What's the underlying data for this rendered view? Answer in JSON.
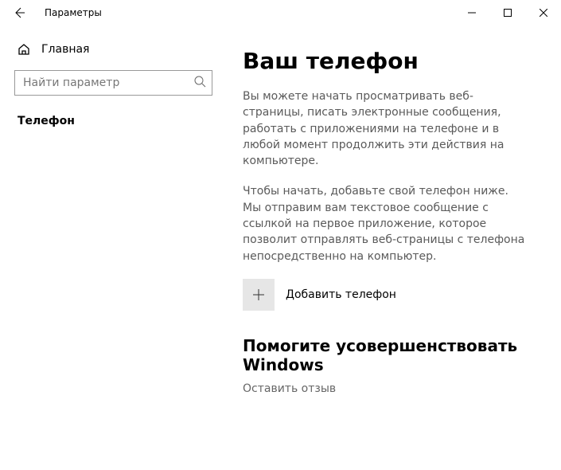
{
  "titlebar": {
    "title": "Параметры"
  },
  "sidebar": {
    "home_label": "Главная",
    "search_placeholder": "Найти параметр",
    "nav": {
      "phone_label": "Телефон"
    }
  },
  "content": {
    "title": "Ваш телефон",
    "paragraph1": "Вы можете начать просматривать веб-страницы, писать электронные сообщения, работать с приложениями на телефоне и в любой момент продолжить эти действия на компьютере.",
    "paragraph2": "Чтобы начать, добавьте свой телефон ниже. Мы отправим вам текстовое сообщение с ссылкой на первое приложение, которое позволит отправлять веб-страницы с телефона непосредственно на компьютер.",
    "add_phone_label": "Добавить телефон",
    "feedback_title": "Помогите усовершенствовать Windows",
    "feedback_link": "Оставить отзыв"
  }
}
